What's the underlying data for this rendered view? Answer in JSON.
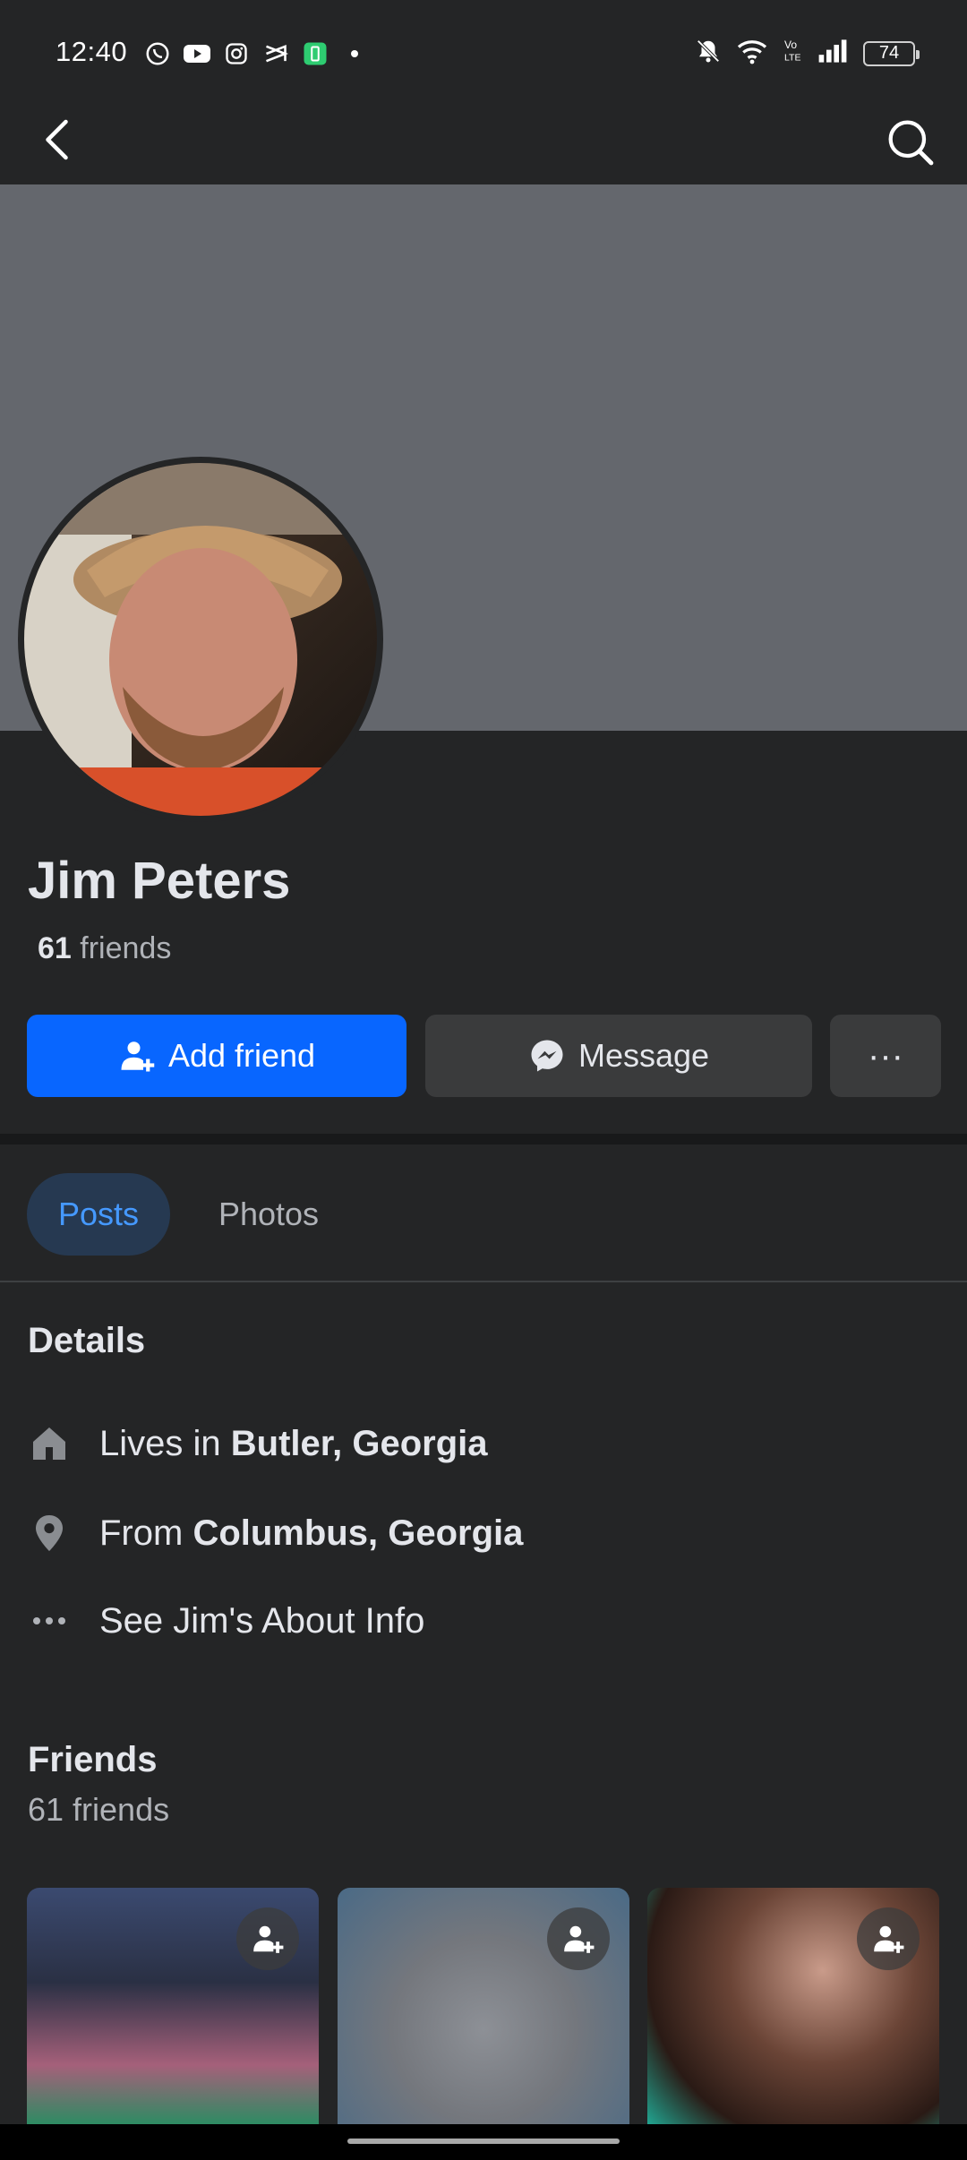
{
  "status_bar": {
    "time": "12:40",
    "battery": "74",
    "left_icons": [
      "whatsapp-icon",
      "youtube-icon",
      "instagram-icon",
      "capcut-icon",
      "battery-app-icon",
      "dot-icon"
    ],
    "right_icons": [
      "mute-bell-icon",
      "wifi-icon",
      "volte-icon",
      "signal-icon"
    ]
  },
  "header": {
    "back_icon": "chevron-left-icon",
    "search_icon": "search-icon"
  },
  "profile": {
    "name": "Jim Peters",
    "friends_number": "61",
    "friends_word": "friends"
  },
  "actions": {
    "add_friend": "Add friend",
    "message": "Message",
    "more": "···"
  },
  "tabs": [
    {
      "label": "Posts",
      "active": true
    },
    {
      "label": "Photos",
      "active": false
    }
  ],
  "details": {
    "title": "Details",
    "lives_prefix": "Lives in ",
    "lives_place": "Butler, Georgia",
    "from_prefix": "From ",
    "from_place": "Columbus, Georgia",
    "about": "See Jim's About Info"
  },
  "friends_section": {
    "title": "Friends",
    "subtitle": "61 friends"
  },
  "colors": {
    "background": "#242526",
    "accent": "#0866ff",
    "secondary_button": "#3a3b3c",
    "active_tab_bg": "#263951",
    "active_tab_text": "#4599ff"
  }
}
